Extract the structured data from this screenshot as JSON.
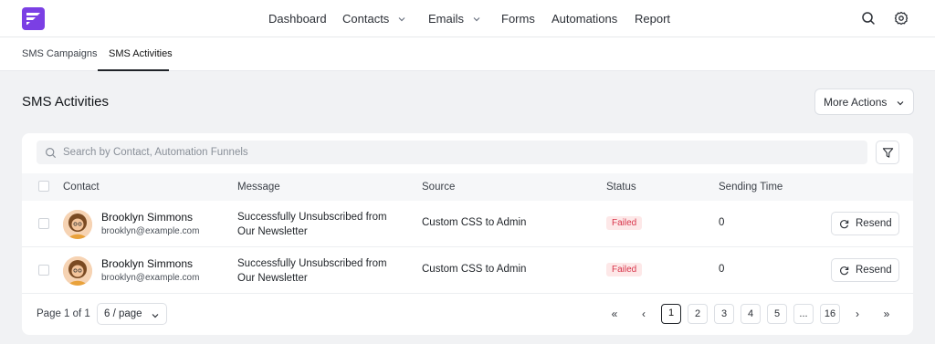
{
  "nav": {
    "dashboard": "Dashboard",
    "contacts": "Contacts",
    "emails": "Emails",
    "forms": "Forms",
    "automations": "Automations",
    "report": "Report"
  },
  "subtabs": {
    "campaigns": "SMS Campaigns",
    "activities": "SMS Activities"
  },
  "page": {
    "title": "SMS Activities",
    "more_actions": "More Actions"
  },
  "search": {
    "placeholder": "Search by Contact, Automation Funnels"
  },
  "table": {
    "headers": {
      "contact": "Contact",
      "message": "Message",
      "source": "Source",
      "status": "Status",
      "sending_time": "Sending Time"
    },
    "rows": [
      {
        "name": "Brooklyn Simmons",
        "email": "brooklyn@example.com",
        "message": "Successfully Unsubscribed from Our Newsletter",
        "source": "Custom CSS to Admin",
        "status": "Failed",
        "sending_time": "0",
        "action": "Resend"
      },
      {
        "name": "Brooklyn Simmons",
        "email": "brooklyn@example.com",
        "message": "Successfully Unsubscribed from Our Newsletter",
        "source": "Custom CSS to Admin",
        "status": "Failed",
        "sending_time": "0",
        "action": "Resend"
      }
    ]
  },
  "pagination": {
    "page_info": "Page 1 of 1",
    "per_page": "6 / page",
    "first": "«",
    "prev": "‹",
    "next": "›",
    "last": "»",
    "pages": [
      "1",
      "2",
      "3",
      "4",
      "5",
      "...",
      "16"
    ],
    "current": "1"
  },
  "colors": {
    "brand": "#7b3fe4",
    "failed_text": "#d8344a",
    "failed_bg": "#fde8e8"
  }
}
